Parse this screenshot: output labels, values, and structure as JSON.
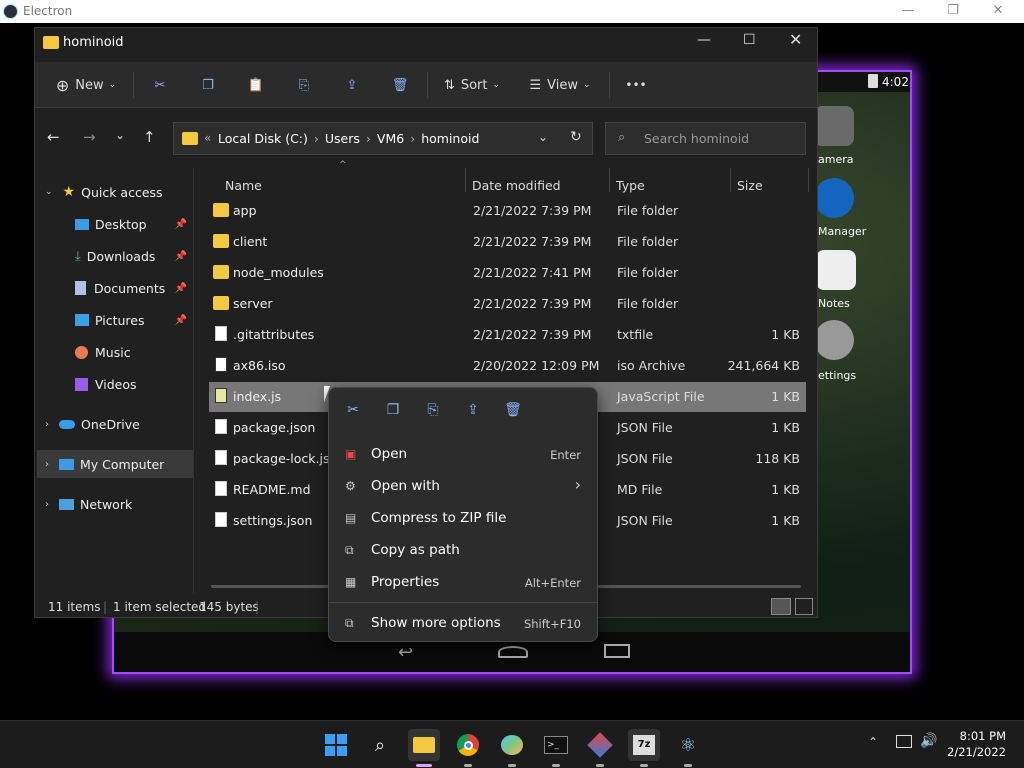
{
  "electron": {
    "title": "Electron"
  },
  "android": {
    "time": "4:02",
    "apps": [
      {
        "label": "amera",
        "icon": "camera-icon",
        "color": "#5a5a5a"
      },
      {
        "label": "Manager",
        "icon": "manager-icon",
        "color": "#1565c0"
      },
      {
        "label": "Notes",
        "icon": "notes-icon",
        "color": "#e0e0e0"
      },
      {
        "label": "ettings",
        "icon": "settings-icon",
        "color": "#9e9e9e"
      }
    ]
  },
  "explorer": {
    "title": "hominoid",
    "toolbar": {
      "new": "New",
      "sort": "Sort",
      "view": "View",
      "more": "•••"
    },
    "address": {
      "prefix": "«",
      "parts": [
        "Local Disk (C:)",
        "Users",
        "VM6",
        "hominoid"
      ],
      "sep": "›"
    },
    "search": {
      "placeholder": "Search hominoid"
    },
    "nav": [
      {
        "label": "Quick access",
        "icon": "star-icon"
      },
      {
        "label": "Desktop",
        "icon": "desktop-icon"
      },
      {
        "label": "Downloads",
        "icon": "download-icon"
      },
      {
        "label": "Documents",
        "icon": "documents-icon"
      },
      {
        "label": "Pictures",
        "icon": "pictures-icon"
      },
      {
        "label": "Music",
        "icon": "music-icon"
      },
      {
        "label": "Videos",
        "icon": "videos-icon"
      },
      {
        "label": "OneDrive",
        "icon": "cloud-icon"
      },
      {
        "label": "My Computer",
        "icon": "computer-icon"
      },
      {
        "label": "Network",
        "icon": "network-icon"
      }
    ],
    "columns": {
      "name": "Name",
      "date": "Date modified",
      "type": "Type",
      "size": "Size"
    },
    "files": [
      {
        "name": "app",
        "date": "2/21/2022 7:39 PM",
        "type": "File folder",
        "size": "",
        "kind": "folder"
      },
      {
        "name": "client",
        "date": "2/21/2022 7:39 PM",
        "type": "File folder",
        "size": "",
        "kind": "folder"
      },
      {
        "name": "node_modules",
        "date": "2/21/2022 7:41 PM",
        "type": "File folder",
        "size": "",
        "kind": "folder"
      },
      {
        "name": "server",
        "date": "2/21/2022 7:39 PM",
        "type": "File folder",
        "size": "",
        "kind": "folder"
      },
      {
        "name": ".gitattributes",
        "date": "2/21/2022 7:39 PM",
        "type": "txtfile",
        "size": "1 KB",
        "kind": "doc"
      },
      {
        "name": "ax86.iso",
        "date": "2/20/2022 12:09 PM",
        "type": "iso Archive",
        "size": "241,664 KB",
        "kind": "iso"
      },
      {
        "name": "index.js",
        "date": "",
        "type": "JavaScript File",
        "size": "1 KB",
        "kind": "js"
      },
      {
        "name": "package.json",
        "date": "",
        "type": "JSON File",
        "size": "1 KB",
        "kind": "doc"
      },
      {
        "name": "package-lock.json",
        "date": "",
        "type": "JSON File",
        "size": "118 KB",
        "kind": "doc"
      },
      {
        "name": "README.md",
        "date": "",
        "type": "MD File",
        "size": "1 KB",
        "kind": "doc"
      },
      {
        "name": "settings.json",
        "date": "",
        "type": "JSON File",
        "size": "1 KB",
        "kind": "doc"
      }
    ],
    "status": {
      "items": "11 items",
      "selected": "1 item selected",
      "bytes": "145 bytes"
    }
  },
  "context_menu": {
    "items": [
      {
        "label": "Open",
        "shortcut": "Enter"
      },
      {
        "label": "Open with",
        "shortcut": "›"
      },
      {
        "label": "Compress to ZIP file",
        "shortcut": ""
      },
      {
        "label": "Copy as path",
        "shortcut": ""
      },
      {
        "label": "Properties",
        "shortcut": "Alt+Enter"
      },
      {
        "label": "Show more options",
        "shortcut": "Shift+F10"
      }
    ]
  },
  "taskbar": {
    "time": "8:01 PM",
    "date": "2/21/2022"
  }
}
